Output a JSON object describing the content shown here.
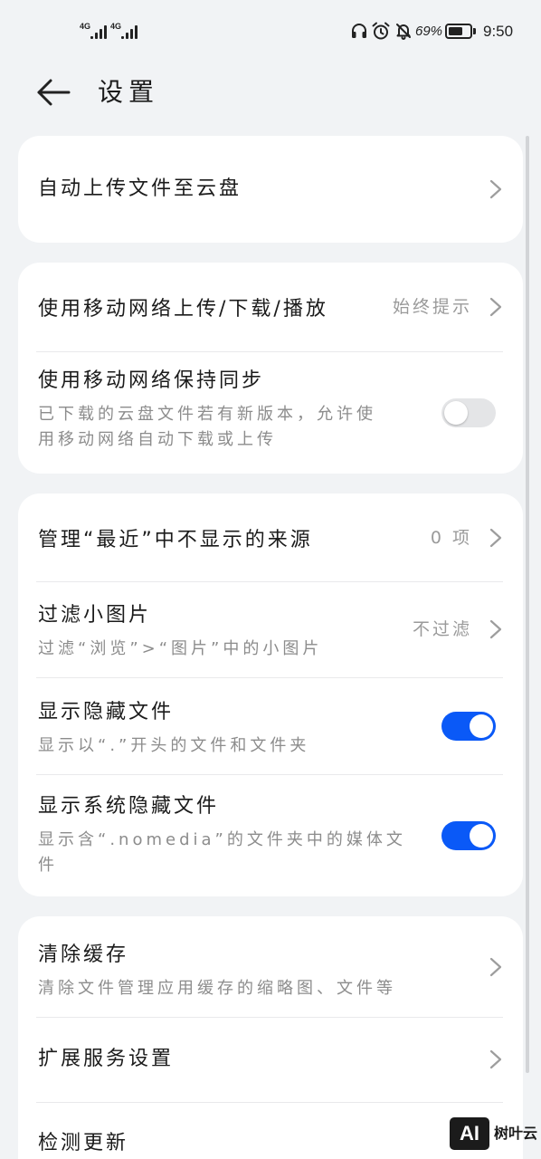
{
  "colors": {
    "background": "#f1f3f5",
    "card": "#ffffff",
    "accent": "#0a59f7",
    "text_primary": "#1b1b1b",
    "text_secondary": "#8c8c8c",
    "toggle_off": "#e4e5e7"
  },
  "status_bar": {
    "signals": [
      {
        "network": "4G",
        "icon": "signal-bars-icon"
      },
      {
        "network": "4G",
        "icon": "signal-bars-icon"
      }
    ],
    "icons": [
      "headphones-icon",
      "alarm-icon",
      "bell-off-icon",
      "battery-icon"
    ],
    "battery_text": "69%",
    "battery_level": 0.69,
    "time": "9:50"
  },
  "header": {
    "back_icon": "arrow-left-icon",
    "title": "设置"
  },
  "sections": [
    {
      "rows": [
        {
          "title": "自动上传文件至云盘",
          "trailing_icon": "chevron-right-icon"
        }
      ]
    },
    {
      "rows": [
        {
          "title": "使用移动网络上传/下载/播放",
          "value": "始终提示",
          "trailing_icon": "chevron-right-icon"
        },
        {
          "title": "使用移动网络保持同步",
          "subtitle_lines": [
            "已下载的云盘文件若有新版本，允许使",
            "用移动网络自动下载或上传"
          ],
          "toggle_on": false
        }
      ]
    },
    {
      "rows": [
        {
          "title": "管理“最近”中不显示的来源",
          "value": "0 项",
          "trailing_icon": "chevron-right-icon"
        },
        {
          "title": "过滤小图片",
          "subtitle_lines": [
            "过滤“浏览”>“图片”中的小图片"
          ],
          "value": "不过滤",
          "trailing_icon": "chevron-right-icon"
        },
        {
          "title": "显示隐藏文件",
          "subtitle_lines": [
            "显示以“.”开头的文件和文件夹"
          ],
          "toggle_on": true
        },
        {
          "title": "显示系统隐藏文件",
          "subtitle_lines": [
            "显示含“.nomedia”的文件夹中的媒体文",
            "件"
          ],
          "toggle_on": true
        }
      ]
    },
    {
      "rows": [
        {
          "title": "清除缓存",
          "subtitle_lines": [
            "清除文件管理应用缓存的缩略图、文件等"
          ],
          "trailing_icon": "chevron-right-icon"
        },
        {
          "title": "扩展服务设置",
          "trailing_icon": "chevron-right-icon"
        },
        {
          "title": "检测更新"
        }
      ]
    }
  ],
  "watermark": {
    "logo_text": "AI",
    "text": "树叶云"
  }
}
